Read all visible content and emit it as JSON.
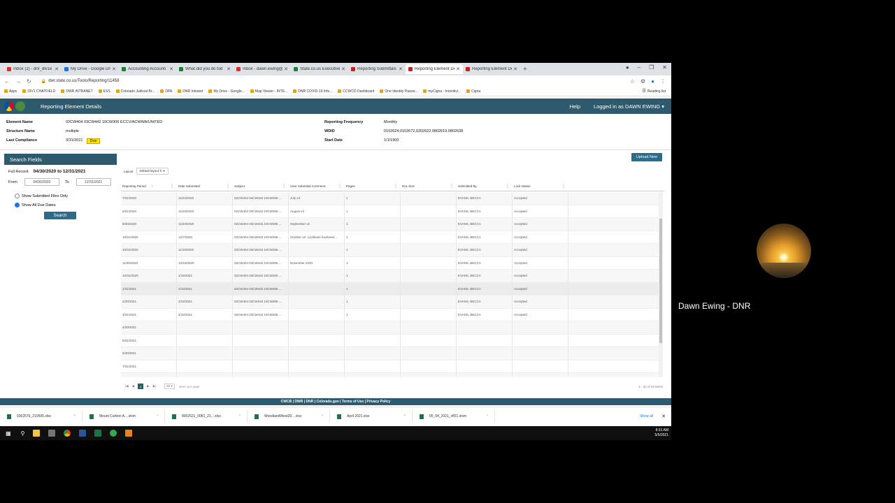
{
  "browser": {
    "tabs": [
      {
        "label": "Inbox (2) - dnr_dlv1e",
        "color": "#d93025"
      },
      {
        "label": "My Drive - Google Dri",
        "color": "#1a73e8"
      },
      {
        "label": "Accounting Accounti",
        "color": "#188038"
      },
      {
        "label": "What did you do tod",
        "color": "#188038"
      },
      {
        "label": "Inbox - dawn.ewing@",
        "color": "#d93025"
      },
      {
        "label": "State.co.us Executive",
        "color": "#188038"
      },
      {
        "label": "Reporting Submittals",
        "color": "#c5221f"
      },
      {
        "label": "Reporting Element De",
        "color": "#c5221f"
      },
      {
        "label": "Reporting Element De",
        "color": "#c5221f"
      }
    ],
    "url": "dwr.state.co.us/Tools/Reporting/11458",
    "bookmarks": [
      "Apps",
      "DIV1 CHATFIELD",
      "DWR INTRANET",
      "ESS",
      "Colorado Judicial Br...",
      "DPA",
      "DNR Intranet",
      "My Drive - Google...",
      "Map Viewer - INTE...",
      "DNR COVID-19 Info...",
      "CCWCD Dashboard",
      "One Identity Passw...",
      "myCigna - Incentivi...",
      "Cigna"
    ],
    "reading_list": "Reading list"
  },
  "app": {
    "title": "Reporting Element Details",
    "help": "Help",
    "user": "Logged in as DAWN EWING ▾"
  },
  "info": {
    "element_name_label": "Element Name",
    "element_name": "02CW404 03CW442 10CW306 ECCV/ACWWA/UNITED",
    "structure_name_label": "Structure Name",
    "structure_name": "multiple",
    "last_compliance_label": "Last Compliance",
    "last_compliance": "3/31/2021",
    "due_badge": "Due",
    "frequency_label": "Reporting Frequency",
    "frequency": "Monthly",
    "wdid_label": "WDID",
    "wdid": "0102624,0102672,0202622,0802619,0802638",
    "start_date_label": "Start Date",
    "start_date": "1/1/1900"
  },
  "search": {
    "title": "Search Fields",
    "full_record_label": "Full Record:",
    "full_record": "04/30/2020 to 12/31/2021",
    "from_label": "From",
    "from": "04/30/2020",
    "to_label": "To",
    "to": "12/31/2021",
    "opt1": "Show Submitted Files Only",
    "opt2": "Show All Due Dates",
    "button": "Search"
  },
  "upload_button": "Upload New",
  "grid": {
    "layout_label": "Layout",
    "layout_value": "Default layout",
    "columns": [
      "Reporting Period",
      "Date Submitted",
      "Subject",
      "User Submittal Comment",
      "Pages",
      "Doc Size",
      "Submitted By",
      "Lock Status"
    ],
    "rows": [
      [
        "7/31/2020",
        "11/23/2020",
        "02CW404 03CW442 10CW306 ...",
        "July v3",
        "1",
        "",
        "EVANS, BECCA",
        "Accepted"
      ],
      [
        "8/31/2020",
        "11/23/2020",
        "02CW404 03CW442 10CW306 ...",
        "August v3",
        "1",
        "",
        "EVANS, BECCA",
        "Accepted"
      ],
      [
        "9/30/2020",
        "11/23/2020",
        "02CW404 03CW442 10CW306 ...",
        "September v2",
        "1",
        "",
        "EVANS, BECCA",
        "Accepted"
      ],
      [
        "10/31/2020",
        "12/7/2020",
        "02CW404 03CW442 10CW306 ...",
        "October v2. Lockbuse bookover...",
        "1",
        "",
        "EVANS, BECCA",
        "Accepted"
      ],
      [
        "10/31/2020",
        "11/19/2020",
        "02CW404 03CW442 10CW306 ...",
        "",
        "1",
        "",
        "EVANS, BECCA",
        "Accepted"
      ],
      [
        "11/30/2020",
        "12/10/2020",
        "02CW404 03CW442 10CW306 ...",
        "November 2020",
        "1",
        "",
        "EVANS, BECCA",
        "Accepted"
      ],
      [
        "12/31/2020",
        "1/15/2021",
        "02CW404 03CW442 10CW306 ...",
        "",
        "1",
        "",
        "EVANS, BECCA",
        "Accepted"
      ],
      [
        "1/31/2021",
        "2/15/2021",
        "02CW404 03CW442 10CW306 ...",
        "",
        "1",
        "",
        "EVANS, BECCA",
        "Accepted"
      ],
      [
        "2/28/2021",
        "3/16/2021",
        "02CW404 03CW442 10CW306 ...",
        "",
        "1",
        "",
        "EVANS, BECCA",
        "Accepted"
      ],
      [
        "3/31/2021",
        "4/15/2021",
        "02CW404 03CW442 10CW306 ...",
        "",
        "1",
        "",
        "EVANS, BECCA",
        "Accepted"
      ],
      [
        "4/30/2021",
        "",
        "",
        "",
        "",
        "",
        "",
        ""
      ],
      [
        "5/31/2021",
        "",
        "",
        "",
        "",
        "",
        "",
        ""
      ],
      [
        "6/30/2021",
        "",
        "",
        "",
        "",
        "",
        "",
        ""
      ],
      [
        "7/31/2021",
        "",
        "",
        "",
        "",
        "",
        "",
        ""
      ],
      [
        "8/31/2021",
        "",
        "",
        "",
        "",
        "",
        "",
        ""
      ]
    ],
    "pager_page": "1",
    "pager_size": "50",
    "pager_items_label": "items per page",
    "pager_count": "1 - 22 of 22 items"
  },
  "footer": "CWCB | DWR | DNR | Colorado.gov | Terms of Use | Privacy Policy",
  "downloads": {
    "items": [
      "0302576_210505.xlsx",
      "Mount Carbon A....xlsm",
      "8002521_0081_21....xlsx",
      "WoodlandWest20....xlsx",
      "April 2021.xlsx",
      "05_04_2021_cff21.xlsm"
    ],
    "show_all": "Show all"
  },
  "taskbar": {
    "time": "8:31 AM",
    "date": "5/5/2021"
  },
  "participant": {
    "name": "Dawn Ewing - DNR"
  }
}
